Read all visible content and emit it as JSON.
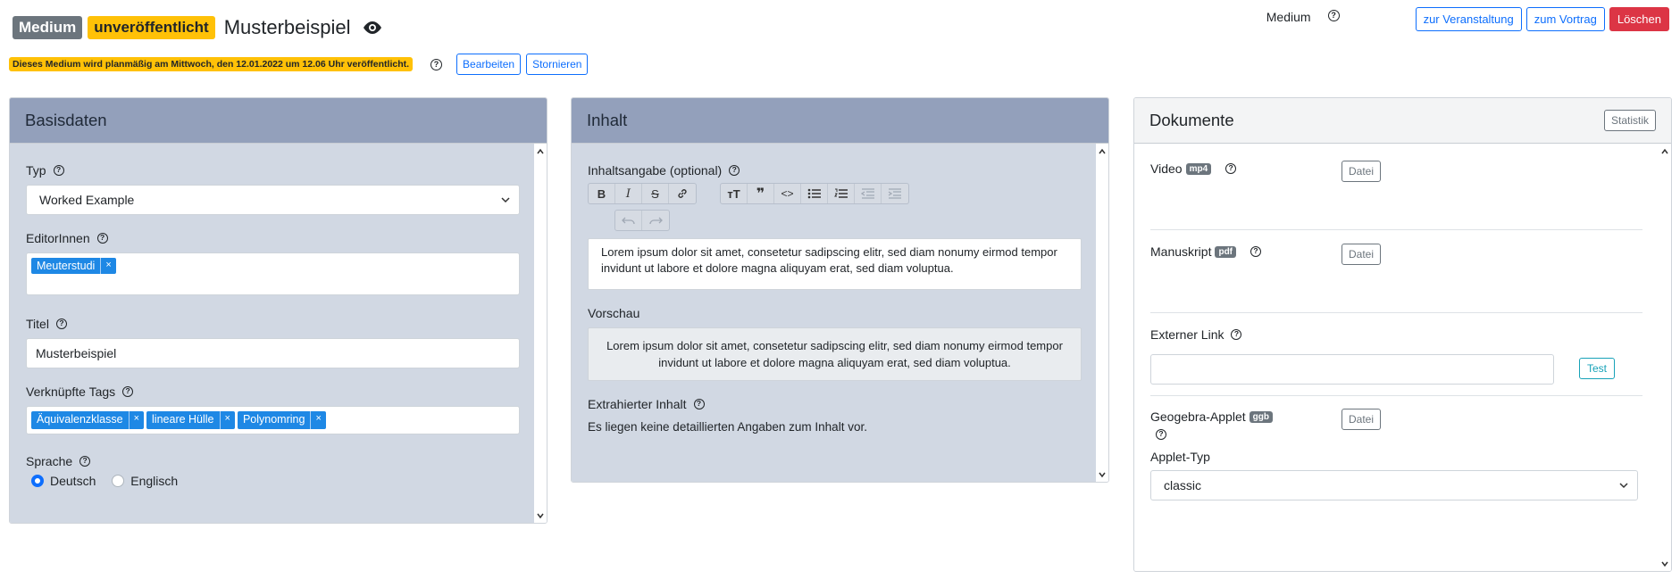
{
  "header": {
    "badge_medium": "Medium",
    "badge_status": "unveröffentlicht",
    "title": "Musterbeispiel",
    "right_label": "Medium",
    "btn_event": "zur Veranstaltung",
    "btn_talk": "zum Vortrag",
    "btn_delete": "Löschen"
  },
  "notice": {
    "text": "Dieses Medium wird planmäßig am Mittwoch, den 12.01.2022 um 12.06 Uhr veröffentlicht.",
    "btn_edit": "Bearbeiten",
    "btn_cancel": "Stornieren"
  },
  "basis": {
    "title": "Basisdaten",
    "type_label": "Typ",
    "type_value": "Worked Example",
    "editors_label": "EditorInnen",
    "editors": [
      "Meuterstudi"
    ],
    "title_label": "Titel",
    "title_value": "Musterbeispiel",
    "tags_label": "Verknüpfte Tags",
    "tags": [
      "Äquivalenzklasse",
      "lineare Hülle",
      "Polynomring"
    ],
    "lang_label": "Sprache",
    "lang_de": "Deutsch",
    "lang_en": "Englisch",
    "lang_selected": "Deutsch"
  },
  "content": {
    "title": "Inhalt",
    "summary_label": "Inhaltsangabe (optional)",
    "editor_text": "Lorem ipsum dolor sit amet, consetetur sadipscing elitr, sed diam nonumy eirmod tempor invidunt ut labore et dolore magna aliquyam erat, sed diam voluptua.",
    "preview_label": "Vorschau",
    "preview_text": "Lorem ipsum dolor sit amet, consetetur sadipscing elitr, sed diam nonumy eirmod tempor invidunt ut labore et dolore magna aliquyam erat, sed diam voluptua.",
    "extracted_label": "Extrahierter Inhalt",
    "extracted_text": "Es liegen keine detaillierten Angaben zum Inhalt vor."
  },
  "docs": {
    "title": "Dokumente",
    "stats_btn": "Statistik",
    "video_label": "Video",
    "video_badge": "mp4",
    "manuscript_label": "Manuskript",
    "manuscript_badge": "pdf",
    "file_btn": "Datei",
    "link_label": "Externer Link",
    "link_value": "",
    "test_btn": "Test",
    "geogebra_label": "Geogebra-Applet",
    "geogebra_badge": "ggb",
    "applet_type_label": "Applet-Typ",
    "applet_type_value": "classic"
  },
  "colors": {
    "primary": "#0d6efd",
    "danger": "#dc3545",
    "warning": "#ffc107",
    "secondary": "#6c757d",
    "card_header_blue": "#93a0bb",
    "card_body_blue": "#d1d8e3",
    "tag": "#1e88e5"
  }
}
